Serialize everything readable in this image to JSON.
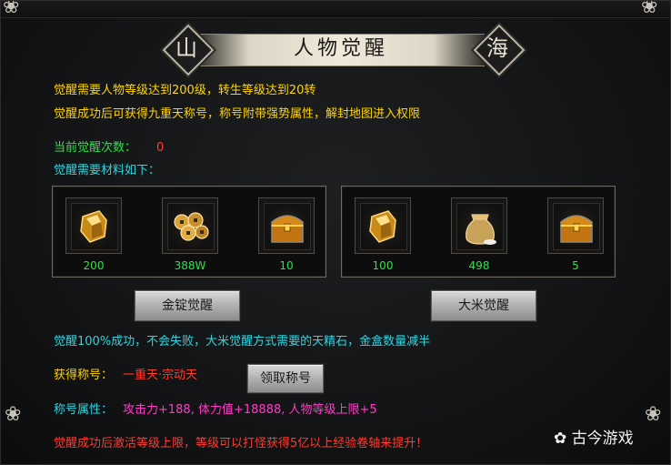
{
  "title": {
    "left_char": "山",
    "main": "人物觉醒",
    "right_char": "海"
  },
  "intro": {
    "line1": "觉醒需要人物等级达到200级，转生等级达到20转",
    "line2": "觉醒成功后可获得九重天称号，称号附带强势属性，解封地图进入权限"
  },
  "awaken_count": {
    "label": "当前觉醒次数：",
    "value": "0"
  },
  "materials_label": "觉醒需要材料如下：",
  "material_groups": [
    {
      "items": [
        {
          "icon": "gold-ingot-icon",
          "qty": "200"
        },
        {
          "icon": "coins-icon",
          "qty": "388W"
        },
        {
          "icon": "treasure-chest-icon",
          "qty": "10"
        }
      ],
      "button": "金锭觉醒"
    },
    {
      "items": [
        {
          "icon": "gold-ingot-icon",
          "qty": "100"
        },
        {
          "icon": "rice-sack-icon",
          "qty": "498"
        },
        {
          "icon": "treasure-chest-icon",
          "qty": "5"
        }
      ],
      "button": "大米觉醒"
    }
  ],
  "note": "觉醒100%成功，不会失败，大米觉醒方式需要的天精石，金盒数量减半",
  "title_reward": {
    "label": "获得称号：",
    "value": "一重天·宗动天",
    "button": "领取称号"
  },
  "title_attr": {
    "label": "称号属性：",
    "value": "攻击力+188, 体力值+18888, 人物等级上限+5"
  },
  "footer_note": "觉醒成功后激活等级上限，等级可以打怪获得5亿以上经验卷轴来提升！",
  "watermark": "古今游戏",
  "colors": {
    "yellow": "#ffd400",
    "green": "#2fe04a",
    "cyan": "#2fd5e0",
    "red": "#ff3b30",
    "magenta": "#ff3bc9"
  }
}
